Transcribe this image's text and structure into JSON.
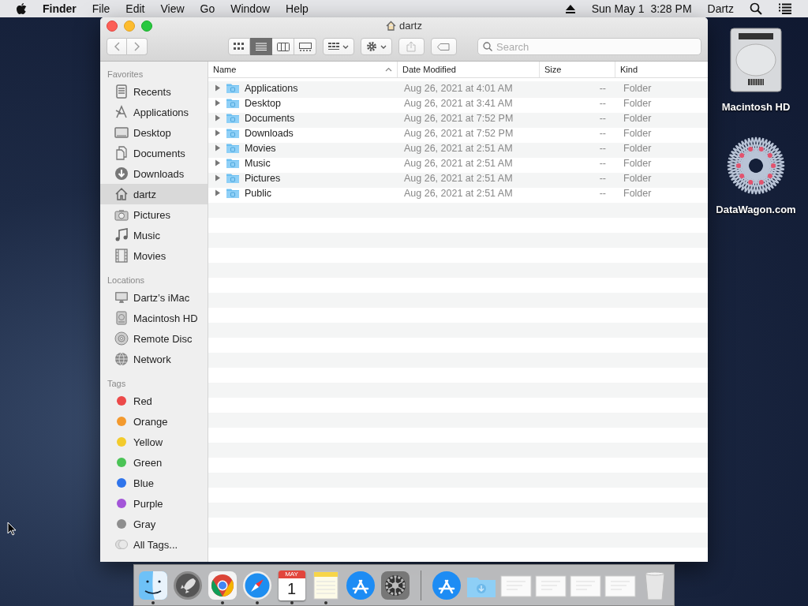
{
  "menubar": {
    "app_name": "Finder",
    "menus": [
      "File",
      "Edit",
      "View",
      "Go",
      "Window",
      "Help"
    ],
    "date": "Sun May 1",
    "time": "3:28 PM",
    "user": "Dartz"
  },
  "window": {
    "title": "dartz",
    "view_modes": [
      {
        "kind": "icons",
        "selected": false
      },
      {
        "kind": "list",
        "selected": true
      },
      {
        "kind": "columns",
        "selected": false
      },
      {
        "kind": "gallery",
        "selected": false
      }
    ],
    "share_disabled": true,
    "search": {
      "placeholder": "Search"
    }
  },
  "sidebar": [
    {
      "heading": "Favorites",
      "items": [
        {
          "label": "Recents",
          "kind": "recents",
          "selected": false
        },
        {
          "label": "Applications",
          "kind": "applications",
          "selected": false
        },
        {
          "label": "Desktop",
          "kind": "desktop",
          "selected": false
        },
        {
          "label": "Documents",
          "kind": "documents",
          "selected": false
        },
        {
          "label": "Downloads",
          "kind": "downloads",
          "selected": false
        },
        {
          "label": "dartz",
          "kind": "home",
          "selected": true
        },
        {
          "label": "Pictures",
          "kind": "pictures",
          "selected": false
        },
        {
          "label": "Music",
          "kind": "music",
          "selected": false
        },
        {
          "label": "Movies",
          "kind": "movies",
          "selected": false
        }
      ]
    },
    {
      "heading": "Locations",
      "items": [
        {
          "label": "Dartz’s iMac",
          "kind": "computer",
          "selected": false
        },
        {
          "label": "Macintosh HD",
          "kind": "disk",
          "selected": false
        },
        {
          "label": "Remote Disc",
          "kind": "disc",
          "selected": false
        },
        {
          "label": "Network",
          "kind": "network",
          "selected": false
        }
      ]
    },
    {
      "heading": "Tags",
      "items": [
        {
          "label": "Red",
          "kind": "tag",
          "color": "#ec4a4a",
          "selected": false
        },
        {
          "label": "Orange",
          "kind": "tag",
          "color": "#f39a2e",
          "selected": false
        },
        {
          "label": "Yellow",
          "kind": "tag",
          "color": "#f3cb2c",
          "selected": false
        },
        {
          "label": "Green",
          "kind": "tag",
          "color": "#4bc356",
          "selected": false
        },
        {
          "label": "Blue",
          "kind": "tag",
          "color": "#2f74eb",
          "selected": false
        },
        {
          "label": "Purple",
          "kind": "tag",
          "color": "#a355d8",
          "selected": false
        },
        {
          "label": "Gray",
          "kind": "tag",
          "color": "#8e8e8e",
          "selected": false
        },
        {
          "label": "All Tags...",
          "kind": "all_tags",
          "selected": false
        }
      ]
    }
  ],
  "table": {
    "columns": [
      {
        "label": "Name",
        "sorted": true
      },
      {
        "label": "Date Modified",
        "sorted": false
      },
      {
        "label": "Size",
        "sorted": false
      },
      {
        "label": "Kind",
        "sorted": false
      }
    ],
    "rows": [
      {
        "name": "Applications",
        "date": "Aug 26, 2021 at 4:01 AM",
        "size": "--",
        "kind": "Folder",
        "expanded": false
      },
      {
        "name": "Desktop",
        "date": "Aug 26, 2021 at 3:41 AM",
        "size": "--",
        "kind": "Folder",
        "expanded": false
      },
      {
        "name": "Documents",
        "date": "Aug 26, 2021 at 7:52 PM",
        "size": "--",
        "kind": "Folder",
        "expanded": false
      },
      {
        "name": "Downloads",
        "date": "Aug 26, 2021 at 7:52 PM",
        "size": "--",
        "kind": "Folder",
        "expanded": false
      },
      {
        "name": "Movies",
        "date": "Aug 26, 2021 at 2:51 AM",
        "size": "--",
        "kind": "Folder",
        "expanded": false
      },
      {
        "name": "Music",
        "date": "Aug 26, 2021 at 2:51 AM",
        "size": "--",
        "kind": "Folder",
        "expanded": false
      },
      {
        "name": "Pictures",
        "date": "Aug 26, 2021 at 2:51 AM",
        "size": "--",
        "kind": "Folder",
        "expanded": false
      },
      {
        "name": "Public",
        "date": "Aug 26, 2021 at 2:51 AM",
        "size": "--",
        "kind": "Folder",
        "expanded": false
      }
    ]
  },
  "desktop_icons": [
    {
      "label": "Macintosh HD",
      "kind": "disk"
    },
    {
      "label": "DataWagon.com",
      "kind": "star"
    }
  ],
  "dock": {
    "apps": [
      {
        "kind": "finder",
        "running": true
      },
      {
        "kind": "launchpad",
        "running": false
      },
      {
        "kind": "chrome",
        "running": true
      },
      {
        "kind": "safari",
        "running": true
      },
      {
        "kind": "calendar",
        "running": true,
        "month": "MAY",
        "day": "1"
      },
      {
        "kind": "notes",
        "running": true
      },
      {
        "kind": "appstore",
        "running": false
      },
      {
        "kind": "settings",
        "running": false
      }
    ],
    "others": [
      {
        "kind": "appstore_stack"
      },
      {
        "kind": "downloads_folder"
      },
      {
        "kind": "document"
      },
      {
        "kind": "document"
      },
      {
        "kind": "document"
      },
      {
        "kind": "document"
      },
      {
        "kind": "trash"
      }
    ]
  }
}
